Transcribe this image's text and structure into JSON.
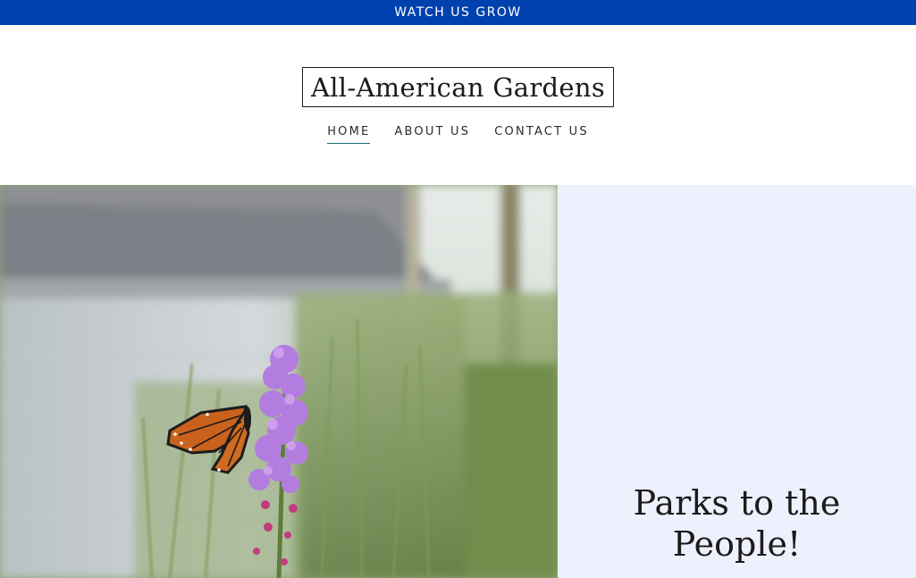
{
  "banner": {
    "text": "WATCH US GROW"
  },
  "header": {
    "logo_text": "All-American Gardens",
    "nav": [
      {
        "label": "HOME",
        "active": true
      },
      {
        "label": "ABOUT US",
        "active": false
      },
      {
        "label": "CONTACT US",
        "active": false
      }
    ]
  },
  "hero": {
    "image_subject": "monarch butterfly on purple blazing star flowers",
    "title_line1": "Parks to the",
    "title_line2": "People!"
  },
  "colors": {
    "banner_bg": "#0042ad",
    "panel_bg": "#eef1fd",
    "nav_underline": "#1c6f74",
    "text_dark": "#1b1b1b"
  }
}
